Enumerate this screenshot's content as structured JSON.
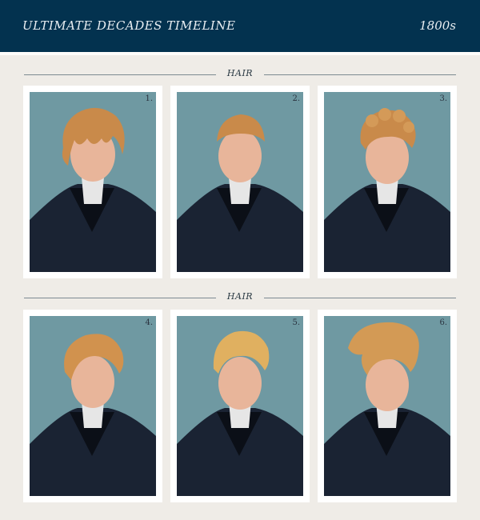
{
  "header": {
    "title": "ULTIMATE DECADES TIMELINE",
    "decade": "1800s"
  },
  "sections": [
    {
      "label": "HAIR",
      "cards": [
        {
          "number": "1.",
          "hair": "curly-wavy"
        },
        {
          "number": "2.",
          "hair": "short-crop"
        },
        {
          "number": "3.",
          "hair": "tight-curls"
        }
      ]
    },
    {
      "label": "HAIR",
      "cards": [
        {
          "number": "4.",
          "hair": "swept-waves"
        },
        {
          "number": "5.",
          "hair": "textured-quiff"
        },
        {
          "number": "6.",
          "hair": "pompadour"
        }
      ]
    }
  ],
  "colors": {
    "header_bg": "#03324f",
    "page_bg": "#efece7",
    "photo_bg": "#6f99a2",
    "hair": "#c98a4a",
    "coat": "#1a2333"
  }
}
